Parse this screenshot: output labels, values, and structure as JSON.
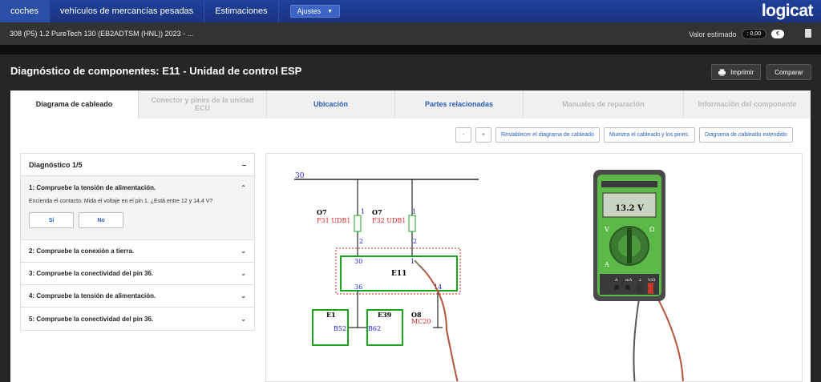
{
  "nav": {
    "tabs": [
      "coches",
      "vehículos de mercancías pesadas",
      "Estimaciones"
    ],
    "settings_label": "Ajustes",
    "logo": "logicat"
  },
  "vehicle": {
    "name": "308 (P5) 1.2 PureTech 130 (EB2ADTSM (HNL)) 2023 - ...",
    "estimate_label": "Valor estimado",
    "estimate_value": ": 0,00",
    "currency": "€"
  },
  "header": {
    "title": "Diagnóstico de componentes: E11 - Unidad de control ESP",
    "print_label": "Imprimir",
    "other_label": "Comparar"
  },
  "tabs": [
    {
      "label": "Diagrama de cableado",
      "state": "active"
    },
    {
      "label": "Conector y pines de la unidad ECU",
      "state": "disabled"
    },
    {
      "label": "Ubicación",
      "state": "normal"
    },
    {
      "label": "Partes relacionadas",
      "state": "normal"
    },
    {
      "label": "Manuales de reparación",
      "state": "disabled"
    },
    {
      "label": "Información del componente",
      "state": "disabled"
    }
  ],
  "toolbar": {
    "zoom_out": "-",
    "zoom_in": "+",
    "reset": "Restablecer el diagrama de cableado",
    "show_pins": "Muestra el cableado y los pines.",
    "extended": "Diagrama de cableado extendido"
  },
  "diagnosis": {
    "title": "Diagnóstico 1/5",
    "collapse": "–",
    "active_step": {
      "title": "1: Compruebe la tensión de alimentación.",
      "text": "Encienda el contacto. Mida el voltaje en el pin 1. ¿Está entre 12 y 14,4 V?",
      "yes": "Sí",
      "no": "No"
    },
    "steps": [
      "2: Compruebe la conexión a tierra.",
      "3: Compruebe la conectividad del pin 36.",
      "4: Compruebe la tensión de alimentación.",
      "5: Compruebe la conectividad del pin 36."
    ]
  },
  "diagram": {
    "bus": "30",
    "fuse1_name": "O7",
    "fuse1_label": "F31 UDB1",
    "fuse2_name": "O7",
    "fuse2_label": "F32 UDB1",
    "pin1": "1",
    "pin2": "2",
    "ecu_name": "E11",
    "ecu_pin30": "30",
    "ecu_pin1": "1",
    "ecu_pin36": "36",
    "ecu_pin14": "14",
    "e1_name": "E1",
    "e1_pin": "B52",
    "e39_name": "E39",
    "e39_pin": "B62",
    "o8_name": "O8",
    "o8_label": "MC20"
  },
  "multimeter": {
    "reading": "13.2 V",
    "mode_v": "V",
    "mode_ohm": "Ω",
    "mode_a": "A",
    "jack_a": "A",
    "jack_ma": "mA",
    "jack_com": "⊥",
    "jack_vohm": "V/Ω"
  },
  "colors": {
    "nav_bg": "#1f3e95",
    "link_blue": "#2b5fb8",
    "box_green": "#1aa31a",
    "label_red": "#d62020",
    "pin_blue": "#2222cc",
    "meter_green": "#5db84a"
  }
}
